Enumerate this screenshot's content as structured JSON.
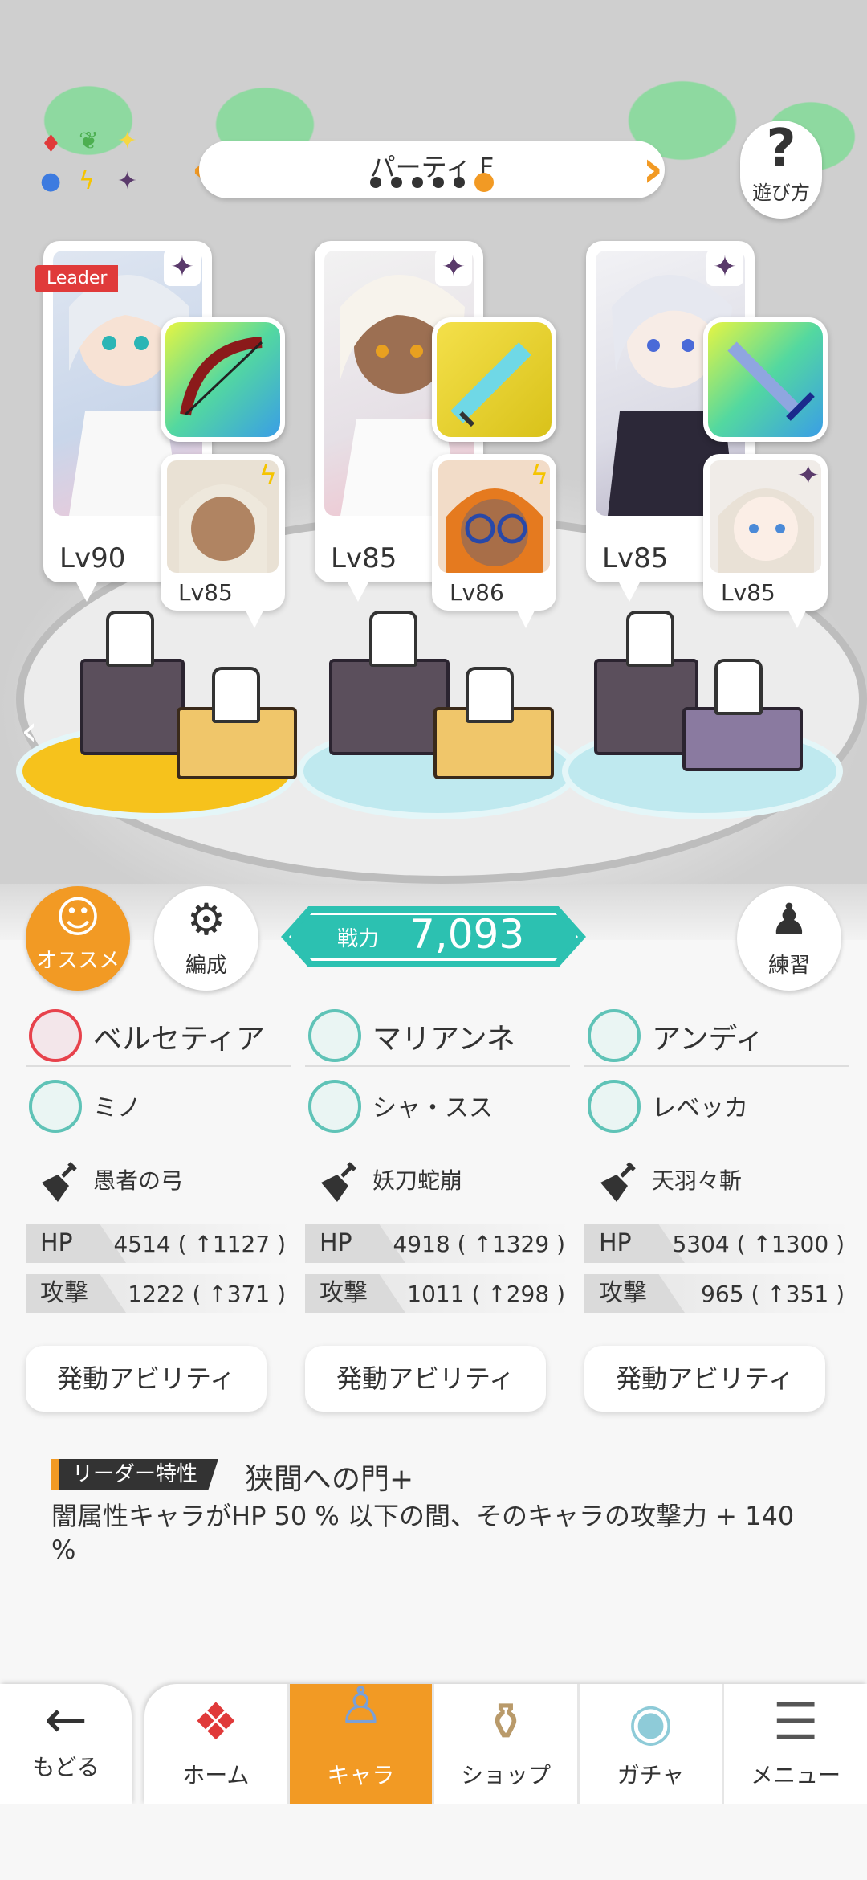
{
  "party": {
    "name": "パーティ F",
    "page_index": 6,
    "page_count": 6
  },
  "help": {
    "label": "遊び方"
  },
  "leader_badge": "Leader",
  "cards": [
    {
      "level": "Lv90",
      "sub_level": "Lv85"
    },
    {
      "level": "Lv85",
      "sub_level": "Lv86"
    },
    {
      "level": "Lv85",
      "sub_level": "Lv85"
    }
  ],
  "buttons": {
    "recommend": "オススメ",
    "formation": "編成",
    "practice": "練習"
  },
  "power": {
    "label": "戦力",
    "value": "7,093"
  },
  "members": [
    {
      "main": "ベルセティア",
      "sub": "ミノ",
      "weapon": "愚者の弓",
      "hp_label": "HP",
      "hp": "4514 ( ↑1127 )",
      "atk_label": "攻撃",
      "atk": "1222 ( ↑371 )",
      "ability": "発動アビリティ"
    },
    {
      "main": "マリアンネ",
      "sub": "シャ・スス",
      "weapon": "妖刀蛇崩",
      "hp_label": "HP",
      "hp": "4918 ( ↑1329 )",
      "atk_label": "攻撃",
      "atk": "1011 ( ↑298 )",
      "ability": "発動アビリティ"
    },
    {
      "main": "アンディ",
      "sub": "レベッカ",
      "weapon": "天羽々斬",
      "hp_label": "HP",
      "hp": "5304 ( ↑1300 )",
      "atk_label": "攻撃",
      "atk": "965 ( ↑351 )",
      "ability": "発動アビリティ"
    }
  ],
  "leader_skill": {
    "tag": "リーダー特性",
    "name": "狭間への門+",
    "description": "闇属性キャラがHP 50 % 以下の間、そのキャラの攻撃力 + 140 %"
  },
  "nav": {
    "back": "もどる",
    "home": "ホーム",
    "chara": "キャラ",
    "shop": "ショップ",
    "gacha": "ガチャ",
    "menu": "メニュー"
  },
  "colors": {
    "accent": "#f29a24",
    "power": "#2cc1b1",
    "leader": "#e03a3a"
  }
}
